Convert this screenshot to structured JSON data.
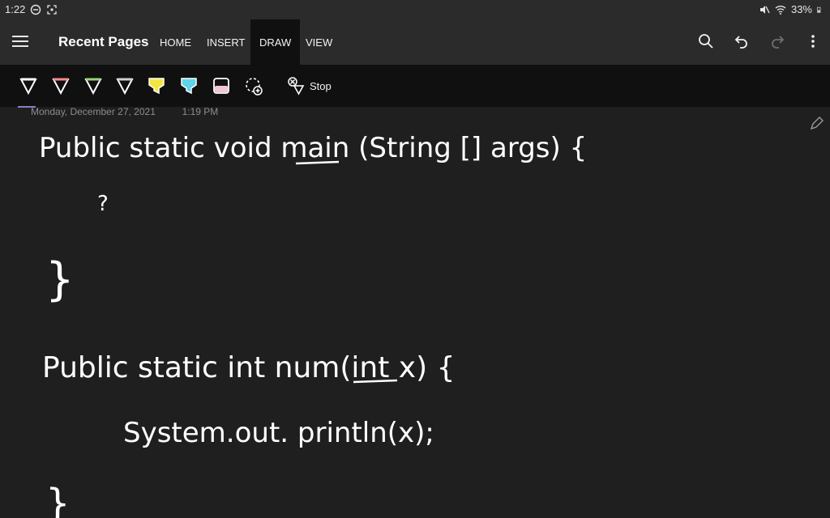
{
  "status_bar": {
    "time": "1:22",
    "battery": "33%"
  },
  "app_bar": {
    "title": "Recent Pages",
    "tabs": [
      "HOME",
      "INSERT",
      "DRAW",
      "VIEW"
    ],
    "active_tab": "DRAW"
  },
  "ribbon": {
    "tools": [
      {
        "name": "pen-white-icon",
        "color": "#ffffff"
      },
      {
        "name": "pen-pink-icon",
        "color": "#f48b8b"
      },
      {
        "name": "pen-green-icon",
        "color": "#9ad37a"
      },
      {
        "name": "pen-gray-icon",
        "color": "#e6e6e6"
      },
      {
        "name": "highlighter-yellow-icon",
        "color": "#f4e542"
      },
      {
        "name": "highlighter-cyan-icon",
        "color": "#5fd3e8"
      },
      {
        "name": "highlighter-pink-icon",
        "color": "#f2c6d1"
      },
      {
        "name": "lasso-add-icon",
        "color": "#ffffff"
      }
    ],
    "stop_label": "Stop"
  },
  "page": {
    "timestamp_date": "Monday, December 27, 2021",
    "timestamp_time": "1:19 PM",
    "ink_lines": [
      "Public static void main (String [] args) {",
      "?",
      "}",
      "Public static int num(int x) {",
      "System.out. println(x);",
      "}"
    ]
  }
}
